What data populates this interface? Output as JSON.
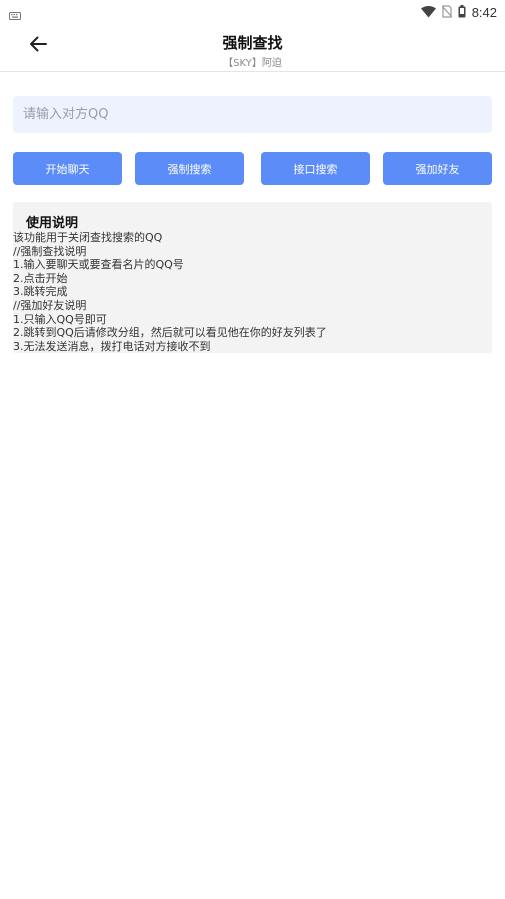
{
  "status_bar": {
    "time": "8:42",
    "icons": [
      "keyboard-icon",
      "wifi-icon",
      "no-sim-icon",
      "battery-icon"
    ]
  },
  "app_bar": {
    "title": "强制查找",
    "subtitle": "【SKY】阿迫",
    "back_icon": "arrow-left-icon"
  },
  "search": {
    "value": "",
    "placeholder": "请输入对方QQ"
  },
  "buttons": {
    "start_chat": "开始聊天",
    "force_search": "强制搜索",
    "api_search": "接口搜索",
    "force_add": "强加好友"
  },
  "instructions": {
    "title": "使用说明",
    "lines": [
      "该功能用于关闭查找搜索的QQ",
      "//强制查找说明",
      "1.输入要聊天或要查看名片的QQ号",
      "2.点击开始",
      "3.跳转完成",
      "//强加好友说明",
      "1.只输入QQ号即可",
      "2.跳转到QQ后请修改分组，然后就可以看见他在你的好友列表了",
      "3.无法发送消息，拨打电话对方接收不到"
    ]
  },
  "colors": {
    "accent": "#5b8cf7",
    "input_bg": "#eef1fe",
    "card_bg": "#f3f3f3"
  }
}
